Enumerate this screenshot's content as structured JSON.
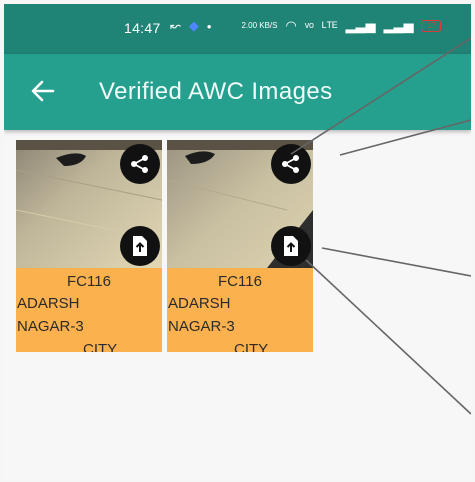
{
  "status_bar": {
    "time": "14:47",
    "net_speed": "2.00 KB/S",
    "battery": "17"
  },
  "app_bar": {
    "title": "Verified AWC Images",
    "back_icon": "arrow-left-icon"
  },
  "cards": [
    {
      "caption_lines": [
        "FC116",
        "ADARSH",
        "NAGAR-3",
        "CITY"
      ],
      "share_icon": "share-icon",
      "upload_icon": "file-upload-icon"
    },
    {
      "caption_lines": [
        "FC116",
        "ADARSH",
        "NAGAR-3",
        "CITY"
      ],
      "share_icon": "share-icon",
      "upload_icon": "file-upload-icon"
    }
  ],
  "colors": {
    "status_bar": "#1f8376",
    "app_bar": "#25a08f",
    "caption_bg": "#fbb14e",
    "button_bg": "#111111"
  }
}
